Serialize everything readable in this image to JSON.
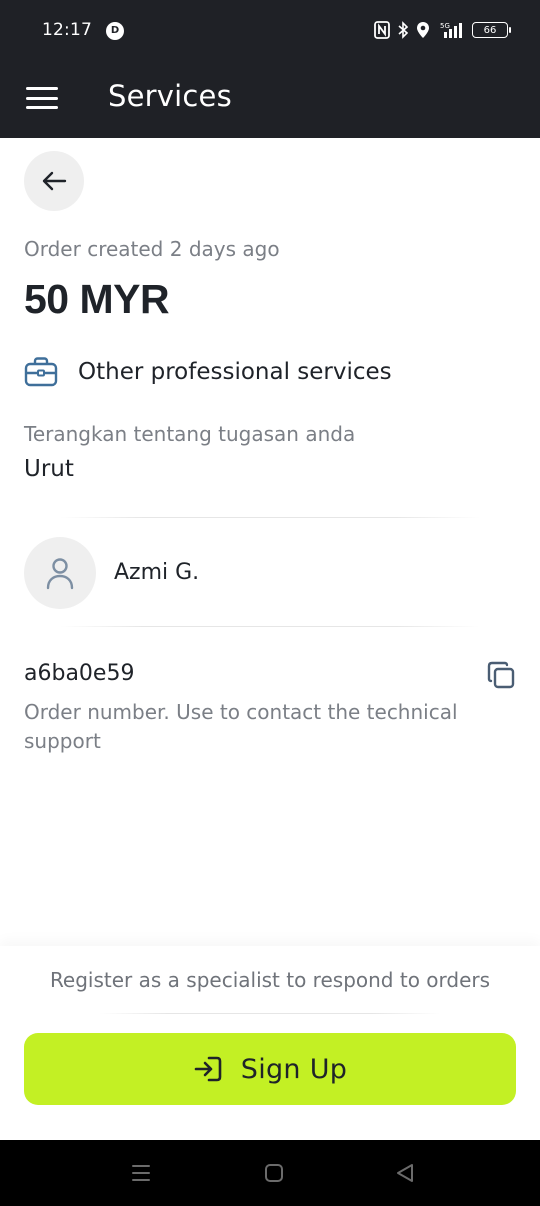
{
  "status_bar": {
    "time": "12:17",
    "app_icon_letter": "D",
    "icons": [
      "nfc-icon",
      "bluetooth-icon",
      "location-icon",
      "5g-signal-icon"
    ],
    "network": "5G",
    "battery": "66"
  },
  "app_bar": {
    "title": "Services",
    "menu_icon": "hamburger-menu-icon"
  },
  "order": {
    "back_icon": "arrow-left-icon",
    "created_text": "Order created 2 days ago",
    "price": "50 MYR",
    "category_icon": "briefcase-icon",
    "category": "Other professional services",
    "description_label": "Terangkan tentang tugasan anda",
    "description_value": "Urut"
  },
  "customer": {
    "avatar_icon": "user-icon",
    "name": "Azmi G."
  },
  "order_number": {
    "value": "a6ba0e59",
    "copy_icon": "copy-icon",
    "hint": "Order number. Use to contact the technical support"
  },
  "register": {
    "text": "Register as a specialist to respond to orders",
    "button_icon": "sign-in-icon",
    "button_label": "Sign Up"
  },
  "colors": {
    "header_bg": "#1f2126",
    "accent": "#c3f024",
    "muted_text": "#7b7f86",
    "text": "#1f2329"
  },
  "nav_bar": {
    "icons": [
      "recent-apps-icon",
      "home-icon",
      "back-triangle-icon"
    ]
  }
}
